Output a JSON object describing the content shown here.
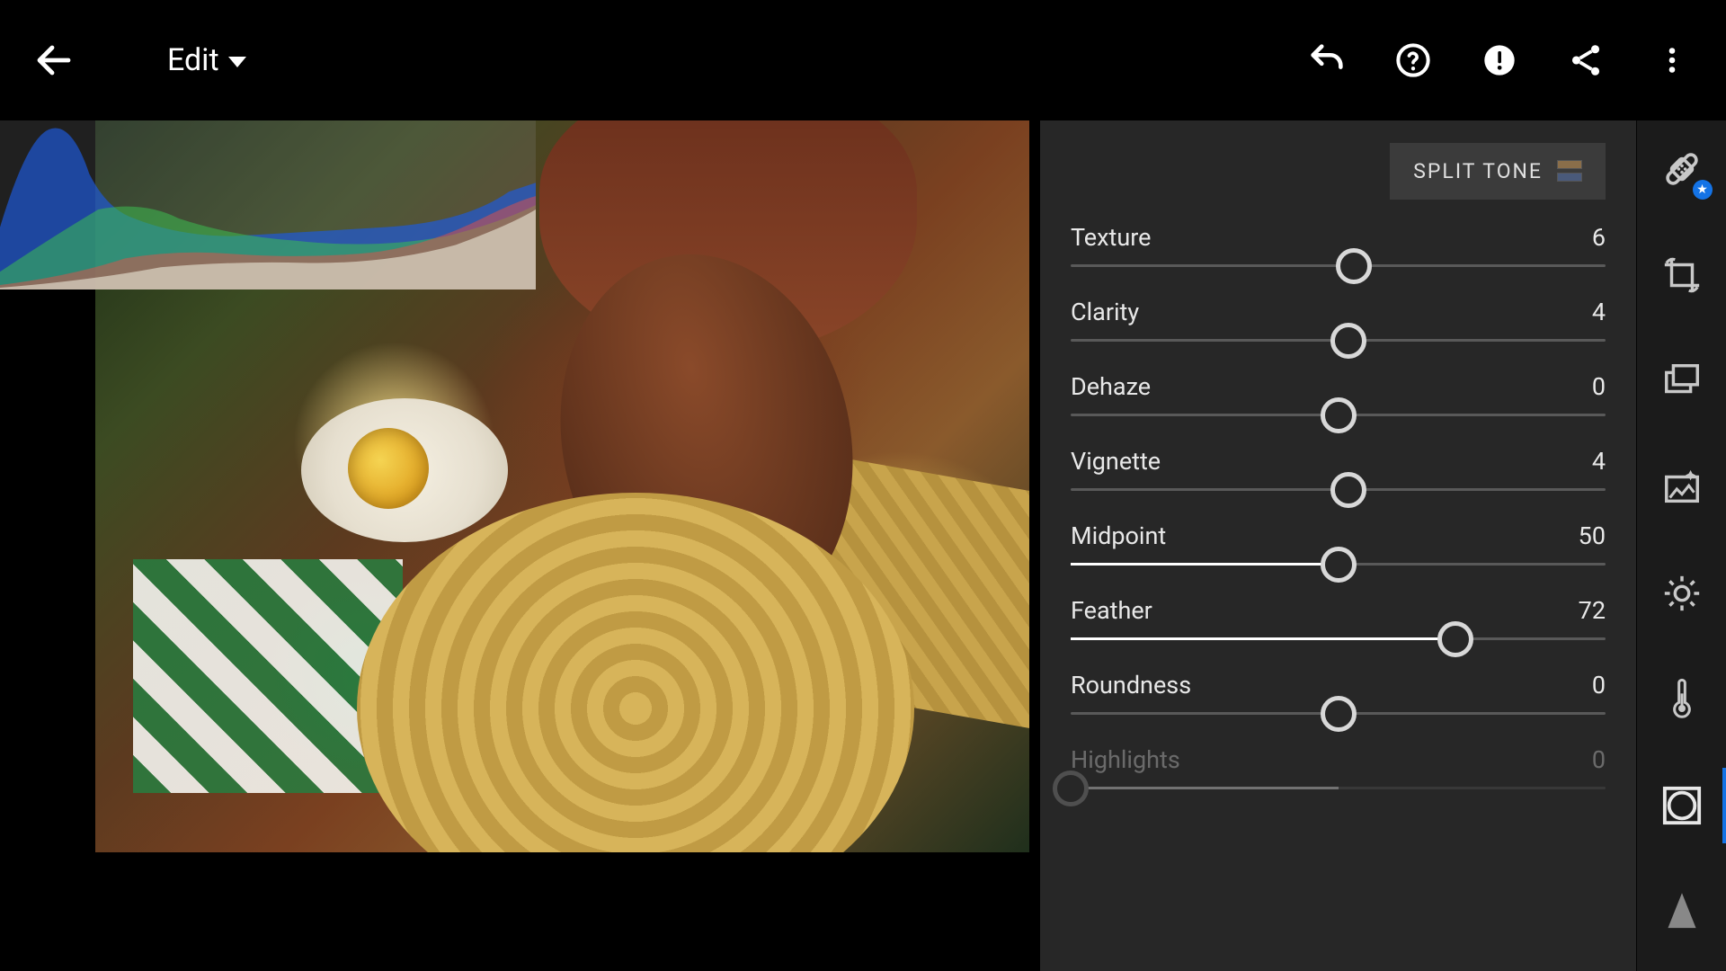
{
  "topbar": {
    "mode_label": "Edit"
  },
  "panel": {
    "split_tone_label": "SPLIT TONE",
    "sliders": [
      {
        "label": "Texture",
        "value": 6,
        "min": -100,
        "max": 100,
        "disabled": false
      },
      {
        "label": "Clarity",
        "value": 4,
        "min": -100,
        "max": 100,
        "disabled": false
      },
      {
        "label": "Dehaze",
        "value": 0,
        "min": -100,
        "max": 100,
        "disabled": false
      },
      {
        "label": "Vignette",
        "value": 4,
        "min": -100,
        "max": 100,
        "disabled": false
      },
      {
        "label": "Midpoint",
        "value": 50,
        "min": 0,
        "max": 100,
        "disabled": false
      },
      {
        "label": "Feather",
        "value": 72,
        "min": 0,
        "max": 100,
        "disabled": false
      },
      {
        "label": "Roundness",
        "value": 0,
        "min": -100,
        "max": 100,
        "disabled": false
      },
      {
        "label": "Highlights",
        "value": 0,
        "min": -100,
        "max": 100,
        "disabled": true,
        "thumb_at_start": true
      }
    ]
  },
  "toolrail": {
    "active": "effects-tool"
  }
}
